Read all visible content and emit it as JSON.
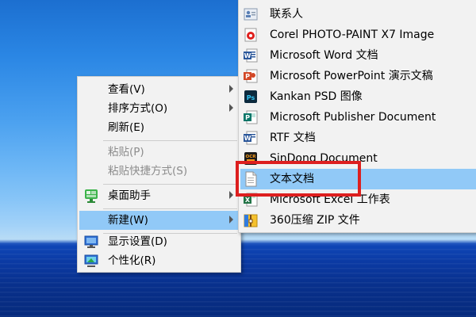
{
  "context_menu": {
    "items": [
      {
        "label": "查看(V)",
        "has_submenu": true
      },
      {
        "label": "排序方式(O)",
        "has_submenu": true
      },
      {
        "label": "刷新(E)"
      },
      {
        "label": "粘贴(P)",
        "disabled": true
      },
      {
        "label": "粘贴快捷方式(S)",
        "disabled": true
      },
      {
        "label": "桌面助手",
        "has_submenu": true,
        "icon": "monitor-icon"
      },
      {
        "label": "新建(W)",
        "has_submenu": true,
        "highlighted": true
      },
      {
        "label": "显示设置(D)",
        "icon": "display-icon"
      },
      {
        "label": "个性化(R)",
        "icon": "personalize-icon"
      }
    ]
  },
  "new_submenu": {
    "items": [
      {
        "label": "联系人",
        "icon": "contact-icon"
      },
      {
        "label": "Corel PHOTO-PAINT X7 Image",
        "icon": "corel-icon"
      },
      {
        "label": "Microsoft Word 文档",
        "icon": "word-icon"
      },
      {
        "label": "Microsoft PowerPoint 演示文稿",
        "icon": "powerpoint-icon"
      },
      {
        "label": "Kankan PSD 图像",
        "icon": "psd-icon"
      },
      {
        "label": "Microsoft Publisher Document",
        "icon": "publisher-icon"
      },
      {
        "label": "RTF 文档",
        "icon": "rtf-icon"
      },
      {
        "label": "SinDong Document",
        "icon": "ocr-icon"
      },
      {
        "label": "文本文档",
        "icon": "text-doc-icon",
        "highlighted": true
      },
      {
        "label": "Microsoft Excel 工作表",
        "icon": "excel-icon"
      },
      {
        "label": "360压缩 ZIP 文件",
        "icon": "zip-icon"
      }
    ]
  },
  "colors": {
    "highlight": "#91c9f7",
    "annotation_box": "#dd1f1f",
    "menu_bg": "#f2f2f2"
  }
}
